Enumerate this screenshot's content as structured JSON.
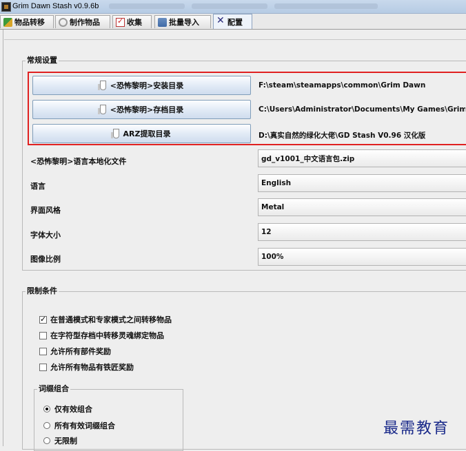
{
  "window": {
    "title": "Grim Dawn Stash v0.9.6b"
  },
  "tabs": [
    {
      "label": "物品转移",
      "icon": "transfer-icon"
    },
    {
      "label": "制作物品",
      "icon": "craft-icon"
    },
    {
      "label": "收集",
      "icon": "collection-icon"
    },
    {
      "label": "批量导入",
      "icon": "import-icon"
    },
    {
      "label": "配置",
      "icon": "config-icon",
      "active": true
    }
  ],
  "general": {
    "title": "常规设置",
    "paths": [
      {
        "button": "<恐怖黎明>安装目录",
        "value": "F:\\steam\\steamapps\\common\\Grim Dawn"
      },
      {
        "button": "<恐怖黎明>存档目录",
        "value": "C:\\Users\\Administrator\\Documents\\My Games\\Grim Dawn\\s"
      },
      {
        "button": "ARZ提取目录",
        "value": "D:\\真实自然的绿化大佬\\GD Stash V0.96 汉化版"
      }
    ],
    "fields": [
      {
        "label": "<恐怖黎明>语言本地化文件",
        "value": "gd_v1001_中文语言包.zip"
      },
      {
        "label": "语言",
        "value": "English"
      },
      {
        "label": "界面风格",
        "value": "Metal"
      },
      {
        "label": "字体大小",
        "value": "12"
      },
      {
        "label": "图像比例",
        "value": "100%"
      }
    ]
  },
  "restrictions": {
    "title": "限制条件",
    "checkboxes": [
      {
        "label": "在普通模式和专家模式之间转移物品",
        "checked": true
      },
      {
        "label": "在字符型存档中转移灵魂绑定物品",
        "checked": false
      },
      {
        "label": "允许所有部件奖励",
        "checked": false
      },
      {
        "label": "允许所有物品有铁匠奖励",
        "checked": false
      }
    ],
    "affix": {
      "title": "词缀组合",
      "options": [
        {
          "label": "仅有效组合",
          "checked": true
        },
        {
          "label": "所有有效词缀组合",
          "checked": false
        },
        {
          "label": "无限制",
          "checked": false
        }
      ]
    }
  },
  "watermark": "最需教育",
  "colors": {
    "highlight_frame": "#e02020",
    "watermark": "#1a2a8a"
  }
}
